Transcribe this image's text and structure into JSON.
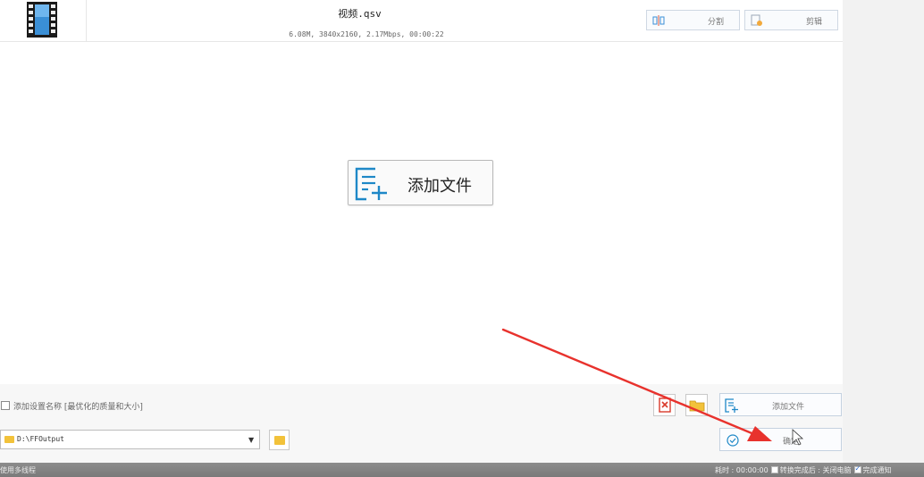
{
  "file": {
    "name": "视频.qsv",
    "meta": "6.08M, 3840x2160, 2.17Mbps, 00:00:22",
    "thumbnail_icon": "film-strip-icon",
    "split_label": "分割",
    "cut_label": "剪辑"
  },
  "center": {
    "add_file_label": "添加文件",
    "icon": "add-file-icon"
  },
  "options": {
    "setting_name_label": "添加设置名称 [最优化的质量和大小]",
    "setting_name_checked": false
  },
  "output": {
    "path": "D:\\FFOutput"
  },
  "actions": {
    "add_file_label": "添加文件",
    "confirm_label": "确定",
    "remove_icon": "remove-file-icon",
    "open_folder_icon": "open-folder-icon"
  },
  "status": {
    "multithread_label": "使用多线程",
    "elapsed_label": "耗时 : 00:00:00",
    "after_convert_label": "转换完成后 : 关闭电脑",
    "after_convert_checked": false,
    "notify_label": "完成通知",
    "notify_checked": true
  },
  "colors": {
    "accent_blue": "#1e88c7",
    "folder_yellow": "#f2c23a",
    "annotation_red": "#e8322d"
  }
}
